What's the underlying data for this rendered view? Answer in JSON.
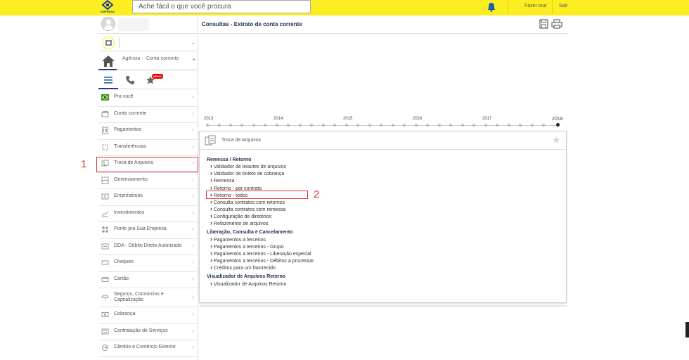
{
  "topbar": {
    "logo_text": "EMPRESA",
    "search_placeholder": "Ache fácil o que você procura",
    "tour_label": "Fazer tour",
    "exit_label": "Sair"
  },
  "sidebar": {
    "home_tabs": [
      "Agência",
      "Conta corrente"
    ],
    "novo_badge": "NOVO",
    "items": [
      {
        "label": "Pra você",
        "icon": "brazil-flag-icon"
      },
      {
        "label": "Conta corrente",
        "icon": "wallet-icon"
      },
      {
        "label": "Pagamentos",
        "icon": "barcode-icon"
      },
      {
        "label": "Transferências",
        "icon": "transfer-icon"
      },
      {
        "label": "Troca de Arquivos",
        "icon": "file-exchange-icon"
      },
      {
        "label": "Gerenciamento",
        "icon": "management-icon"
      },
      {
        "label": "Empréstimos",
        "icon": "loan-icon"
      },
      {
        "label": "Investimentos",
        "icon": "chart-icon"
      },
      {
        "label": "Ponto pra Sua Empresa",
        "icon": "dots-icon"
      },
      {
        "label": "DDA - Débito Direto Autorizado",
        "icon": "dda-icon"
      },
      {
        "label": "Cheques",
        "icon": "check-icon"
      },
      {
        "label": "Cartão",
        "icon": "card-icon"
      },
      {
        "label": "Seguros, Consórcios e Capitalização",
        "icon": "umbrella-icon"
      },
      {
        "label": "Cobrança",
        "icon": "billing-icon"
      },
      {
        "label": "Contratação de Serviços",
        "icon": "contract-icon"
      },
      {
        "label": "Câmbio e Comércio Exterior",
        "icon": "exchange-icon"
      }
    ]
  },
  "annotations": {
    "num1": "1",
    "num2": "2"
  },
  "main": {
    "title": "Consultas - Extrato de conta corrente",
    "timeline_years": [
      "2013",
      "2014",
      "2015",
      "2016",
      "2017",
      "2018"
    ]
  },
  "panel": {
    "title": "Troca de Arquivos",
    "sections": [
      {
        "title": "Remessa / Retorno",
        "links": [
          "Validador de leiautes de arquivos",
          "Validador de boleto de cobrança",
          "Remessa",
          "Retorno - por contrato",
          "Retorno - todos",
          "Consulta contratos com retornos",
          "Consulta contratos com remessa",
          "Configuração de diretórios",
          "Refazimento de arquivos"
        ]
      },
      {
        "title": "Liberação, Consulta e Cancelamento",
        "links": [
          "Pagamentos a terceiros",
          "Pagamentos a terceiros - Grupo",
          "Pagamentos a terceiros - Liberação especial",
          "Pagamentos a terceiros - Débitos a processar",
          "Créditos para um favorecido"
        ]
      },
      {
        "title": "Visualizador de Arquivos Retorno",
        "links": [
          "Visualizador de Arquivos Retorno"
        ]
      }
    ]
  }
}
